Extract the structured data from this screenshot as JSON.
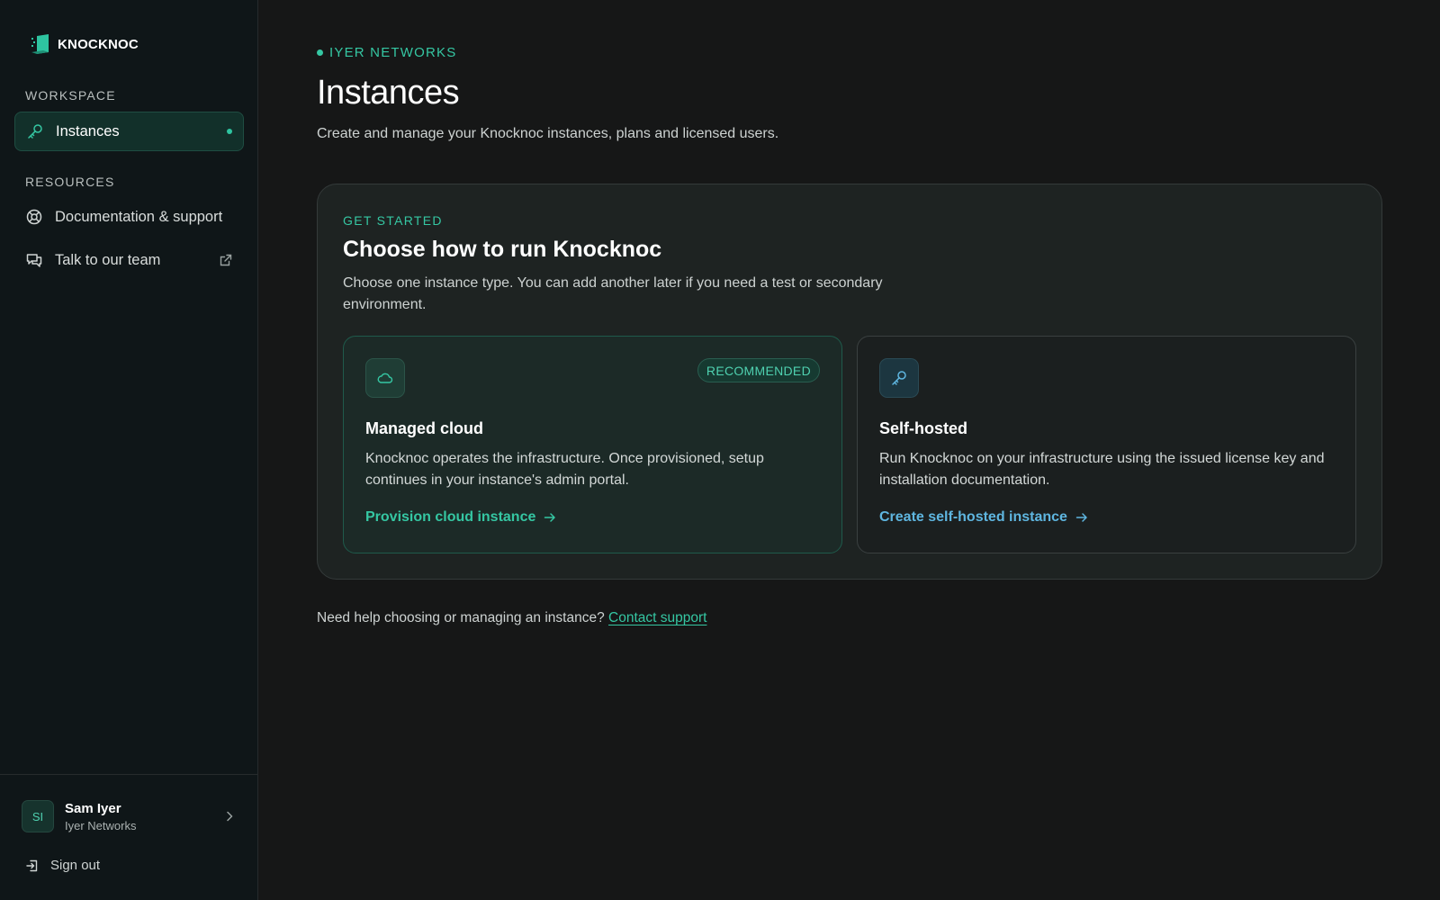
{
  "brand": {
    "name": "KNOCKNOC"
  },
  "sidebar": {
    "workspace_label": "WORKSPACE",
    "workspace_items": [
      {
        "label": "Instances",
        "icon": "key-icon",
        "active": true
      }
    ],
    "resources_label": "RESOURCES",
    "resources_items": [
      {
        "label": "Documentation & support",
        "icon": "lifebuoy-icon"
      },
      {
        "label": "Talk to our team",
        "icon": "chat-icon",
        "trailing_icon": "external-link-icon"
      }
    ],
    "user": {
      "initials": "SI",
      "name": "Sam Iyer",
      "org": "Iyer Networks"
    },
    "signout_label": "Sign out"
  },
  "header": {
    "org_tag": "IYER NETWORKS",
    "title": "Instances",
    "subtitle": "Create and manage your Knocknoc instances, plans and licensed users."
  },
  "panel": {
    "eyebrow": "GET STARTED",
    "title": "Choose how to run Knocknoc",
    "description": "Choose one instance type. You can add another later if you need a test or secondary environment.",
    "cards": [
      {
        "icon": "cloud-icon",
        "badge": "RECOMMENDED",
        "title": "Managed cloud",
        "description": "Knocknoc operates the infrastructure. Once provisioned, setup continues in your instance's admin portal.",
        "link": "Provision cloud instance"
      },
      {
        "icon": "key-icon",
        "title": "Self-hosted",
        "description": "Run Knocknoc on your infrastructure using the issued license key and installation documentation.",
        "link": "Create self-hosted instance"
      }
    ]
  },
  "help": {
    "text": "Need help choosing or managing an instance?",
    "link": "Contact support"
  },
  "colors": {
    "accent": "#35c7a3",
    "self_hosted_link": "#5fb6e0",
    "background": "#161717",
    "sidebar": "#0f1618"
  }
}
